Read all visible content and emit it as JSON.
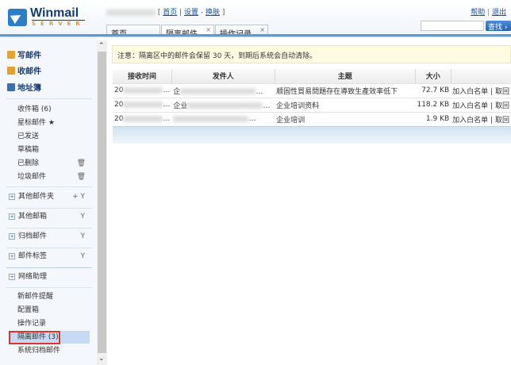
{
  "header": {
    "logo_text": "Winmail",
    "logo_sub": "SERVER",
    "user_links": [
      "首页",
      "设置",
      "换肤"
    ],
    "help": "帮助",
    "logout": "退出",
    "search_placeholder": "",
    "search_button": "查找 ›"
  },
  "tabs": [
    {
      "label": "首页",
      "closable": false
    },
    {
      "label": "隔离邮件",
      "closable": true
    },
    {
      "label": "操作记录",
      "closable": true
    }
  ],
  "sidebar": {
    "actions": [
      {
        "label": "写邮件",
        "icon": "compose-icon"
      },
      {
        "label": "收邮件",
        "icon": "receive-icon"
      },
      {
        "label": "地址簿",
        "icon": "address-book-icon"
      }
    ],
    "folders": [
      {
        "label": "收件箱 (6)"
      },
      {
        "label": "星标邮件 ★"
      },
      {
        "label": "已发送"
      },
      {
        "label": "草稿箱"
      },
      {
        "label": "已删除",
        "extra": "🗑"
      },
      {
        "label": "垃圾邮件",
        "extra": "🗑"
      }
    ],
    "groups": [
      {
        "label": "其他邮件夹",
        "extra": "+  Y"
      },
      {
        "label": "其他邮箱",
        "extra": "Y"
      },
      {
        "label": "归档邮件",
        "extra": "Y"
      },
      {
        "label": "邮件标签",
        "extra": "Y"
      },
      {
        "label": "网络助理"
      }
    ],
    "tools": [
      {
        "label": "新邮件提醒"
      },
      {
        "label": "配置箱"
      },
      {
        "label": "操作记录"
      },
      {
        "label": "隔离邮件 (3)",
        "active": true
      },
      {
        "label": "系统归档邮件"
      }
    ]
  },
  "main": {
    "notice": "注意：隔离区中的邮件会保留 30 天，到期后系统会自动清除。",
    "columns": [
      "接收时间",
      "发件人",
      "主题",
      "大小",
      ""
    ],
    "rows": [
      {
        "time": "20",
        "sender": "企",
        "subject": "顺固性貿易問題存在導致生產效率低下",
        "size": "72.7 KB"
      },
      {
        "time": "20",
        "sender": "企业",
        "subject": "企业培训资料",
        "size": "118.2 KB"
      },
      {
        "time": "20",
        "sender": "",
        "subject": "企业培训",
        "size": "1.9 KB"
      }
    ],
    "whitelist_action": "加入白名单",
    "retrieve_action": "取回",
    "separator": "|"
  }
}
